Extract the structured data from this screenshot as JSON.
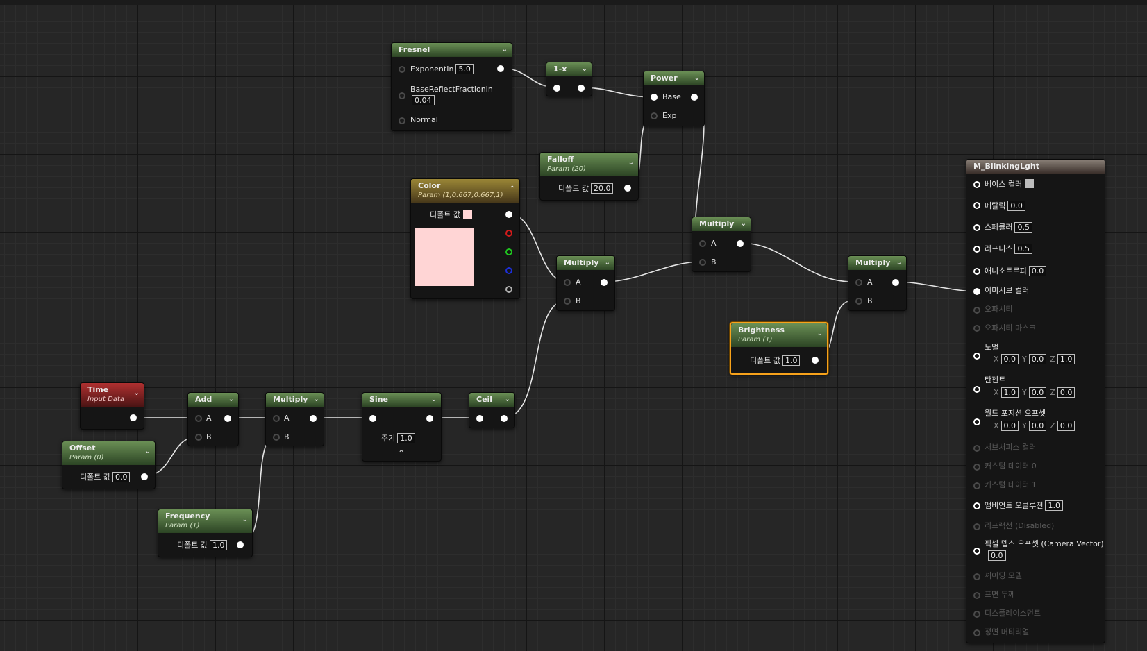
{
  "colors": {
    "pink_swatch": "#ffd5d5",
    "base_swatch": "#bdbdbd",
    "wire": "#e6e6e6",
    "selection": "#f7a21b"
  },
  "fresnel": {
    "title": "Fresnel",
    "exponent_label": "ExponentIn",
    "exponent_value": "5.0",
    "base_reflect_label": "BaseReflectFractionIn",
    "base_reflect_value": "0.04",
    "normal_label": "Normal"
  },
  "one_minus": {
    "title": "1-x"
  },
  "power": {
    "title": "Power",
    "base_label": "Base",
    "exp_label": "Exp"
  },
  "falloff": {
    "title": "Falloff",
    "subtitle": "Param (20)",
    "default_label": "디폴트 값",
    "default_value": "20.0"
  },
  "color": {
    "title": "Color",
    "subtitle": "Param (1,0.667,0.667,1)",
    "default_label": "디폴트 값"
  },
  "multiply_color": {
    "title": "Multiply",
    "a": "A",
    "b": "B"
  },
  "multiply_mid": {
    "title": "Multiply",
    "a": "A",
    "b": "B"
  },
  "multiply_out": {
    "title": "Multiply",
    "a": "A",
    "b": "B"
  },
  "brightness": {
    "title": "Brightness",
    "subtitle": "Param (1)",
    "default_label": "디폴트 값",
    "default_value": "1.0"
  },
  "time": {
    "title": "Time",
    "subtitle": "Input Data"
  },
  "offset": {
    "title": "Offset",
    "subtitle": "Param (0)",
    "default_label": "디폴트 값",
    "default_value": "0.0"
  },
  "add": {
    "title": "Add",
    "a": "A",
    "b": "B"
  },
  "multiply_time": {
    "title": "Multiply",
    "a": "A",
    "b": "B"
  },
  "frequency": {
    "title": "Frequency",
    "subtitle": "Param (1)",
    "default_label": "디폴트 값",
    "default_value": "1.0"
  },
  "sine": {
    "title": "Sine",
    "period_label": "주기",
    "period_value": "1.0"
  },
  "ceil": {
    "title": "Ceil"
  },
  "material": {
    "title": "M_BlinkingLght",
    "base_color": "베이스 컬러",
    "metallic": "메탈릭",
    "metallic_value": "0.0",
    "specular": "스페큘러",
    "specular_value": "0.5",
    "roughness": "러프니스",
    "roughness_value": "0.5",
    "anisotropy": "애니소트로피",
    "anisotropy_value": "0.0",
    "emissive": "이미시브 컬러",
    "opacity": "오파시티",
    "opacity_mask": "오파시티 마스크",
    "normal": "노멀",
    "normal_x": "0.0",
    "normal_y": "0.0",
    "normal_z": "1.0",
    "tangent": "탄젠트",
    "tangent_x": "1.0",
    "tangent_y": "0.0",
    "tangent_z": "0.0",
    "wpo": "월드 포지션 오프셋",
    "wpo_x": "0.0",
    "wpo_y": "0.0",
    "wpo_z": "0.0",
    "axis_x": "X",
    "axis_y": "Y",
    "axis_z": "Z",
    "subsurface": "서브서피스 컬러",
    "custom0": "커스텀 데이터 0",
    "custom1": "커스텀 데이터 1",
    "ao": "앰비언트 오클루전",
    "ao_value": "1.0",
    "refraction": "리프랙션 (Disabled)",
    "pdo": "픽셀 뎁스 오프셋 (Camera Vector)",
    "pdo_value": "0.0",
    "shading_model": "셰이딩 모델",
    "surface_thickness": "표면 두께",
    "displacement": "디스플레이스먼트",
    "front_material": "정면 머티리얼"
  }
}
